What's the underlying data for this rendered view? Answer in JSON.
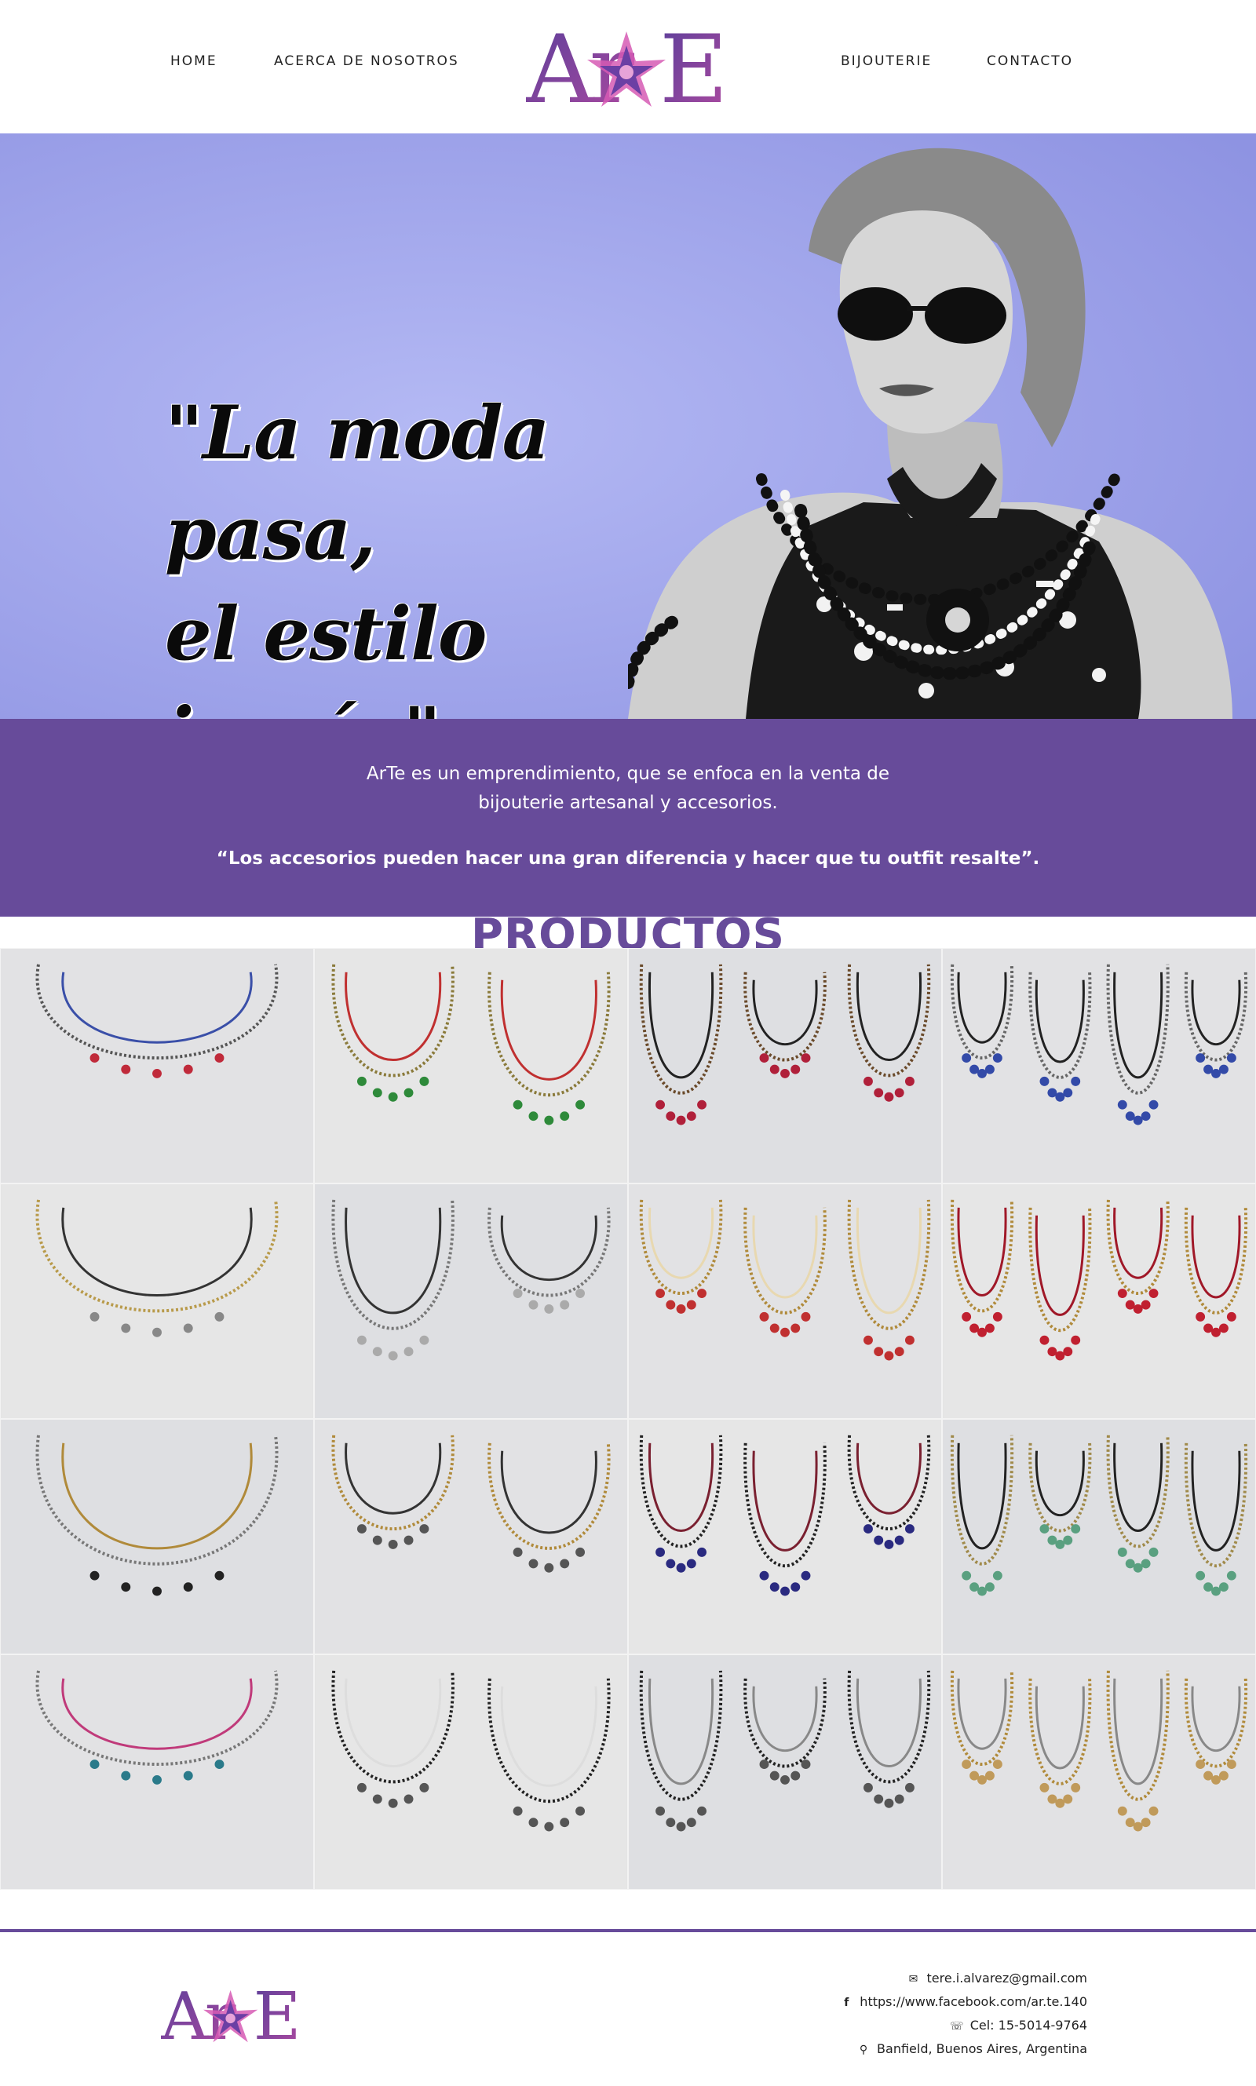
{
  "nav": {
    "home": "HOME",
    "about": "ACERCA DE NOSOTROS",
    "bijouterie": "BIJOUTERIE",
    "contact": "CONTACTO"
  },
  "logo": {
    "text": "ArTe",
    "color": "#6a4da0",
    "accent": "#c04a9a"
  },
  "hero": {
    "quote_line1": "\"La moda pasa,",
    "quote_line2": "el estilo jamás\"",
    "bg_color": "#9ea3ea"
  },
  "about": {
    "line1": "ArTe es un emprendimiento, que se enfoca en la venta de",
    "line2": "bijouterie artesanal y accesorios.",
    "slogan": "“Los accesorios pueden hacer una gran diferencia y hacer que tu outfit resalte”.",
    "bg_color": "#674b9a"
  },
  "products": {
    "title": "PRODUCTOS",
    "items": [
      "necklace-photo-1",
      "necklace-photo-2",
      "necklace-photo-3",
      "necklace-photo-4",
      "necklace-photo-5",
      "necklace-photo-6",
      "necklace-photo-7",
      "necklace-photo-8",
      "necklace-photo-9",
      "necklace-photo-10",
      "necklace-photo-11",
      "necklace-photo-12",
      "necklace-photo-13",
      "necklace-photo-14",
      "necklace-photo-15",
      "necklace-photo-16"
    ]
  },
  "footer": {
    "email": "tere.i.alvarez@gmail.com",
    "facebook": "https://www.facebook.com/ar.te.140",
    "phone": "Cel: 15-5014-9764",
    "address": "Banfield, Buenos Aires, Argentina",
    "icons": [
      "envelope-icon",
      "facebook-icon",
      "phone-icon",
      "map-pin-icon"
    ]
  }
}
